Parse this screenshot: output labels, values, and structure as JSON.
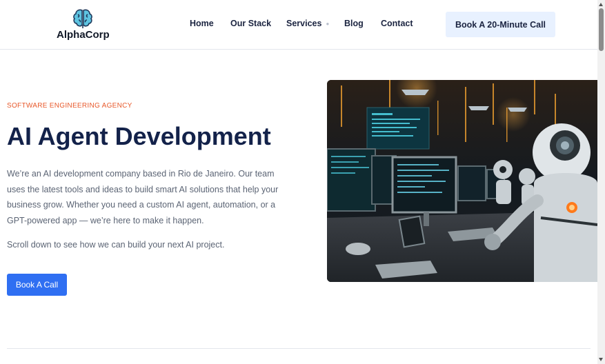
{
  "brand": {
    "name": "AlphaCorp",
    "logo_icon": "brain-icon"
  },
  "nav": {
    "items": [
      {
        "label": "Home"
      },
      {
        "label": "Our Stack"
      },
      {
        "label": "Services",
        "has_dropdown": true
      },
      {
        "label": "Blog"
      },
      {
        "label": "Contact"
      }
    ],
    "cta_label": "Book A 20-Minute Call"
  },
  "hero": {
    "eyebrow": "SOFTWARE ENGINEERING AGENCY",
    "title": "AI Agent Development",
    "description": "We’re an AI development company based in Rio de Janeiro. Our team uses the latest tools and ideas to build smart AI solutions that help your business grow. Whether you need a custom AI agent, automation, or a GPT-powered app — we’re here to make it happen.",
    "description_2": "Scroll down to see how we can build your next AI project.",
    "cta_label": "Book A Call"
  },
  "colors": {
    "accent": "#2f6ff2",
    "eyebrow": "#e8592b",
    "heading": "#13224a",
    "cta_light": "#e8f1ff"
  }
}
